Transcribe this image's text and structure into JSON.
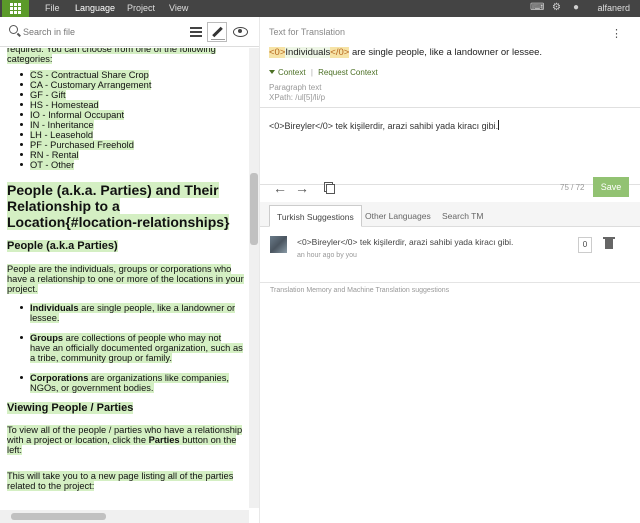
{
  "topbar": {
    "menus": [
      "File",
      "Language",
      "Project",
      "View"
    ],
    "active_menu": "Language",
    "user": "alfanerd"
  },
  "search": {
    "placeholder": "Search in file"
  },
  "document": {
    "intro_fragment": "required. You can choose from one of the following categories:",
    "categories": [
      "CS - Contractual Share Crop",
      "CA - Customary Arrangement",
      "GF - Gift",
      "HS - Homestead",
      "IO - Informal Occupant",
      "IN - Inheritance",
      "LH - Leasehold",
      "PF - Purchased Freehold",
      "RN - Rental",
      "OT - Other"
    ],
    "h1": "People (a.k.a. Parties) and Their Relationship to a Location{#location-relationships}",
    "h2_people": "People (a.k.a Parties)",
    "people_para": "People are the individuals, groups or corporations who have a relationship to one or more of the locations in your project.",
    "party_types": [
      {
        "term": "Individuals",
        "desc": " are single people, like a landowner or lessee."
      },
      {
        "term": "Groups",
        "desc": " are collections of people who may not have an officially documented organization, such as a tribe, community group or family."
      },
      {
        "term": "Corporations",
        "desc": " are organizations like companies, NGOs, or government bodies."
      }
    ],
    "h2_viewing": "Viewing People / Parties",
    "view_para_a": "To view all of the people / parties who have a relationship with a project or location, click the ",
    "view_para_b": "Parties",
    "view_para_c": " button on the left:",
    "new_page_para": "This will take you to a new page listing all of the parties related to the project:"
  },
  "editor": {
    "source_label": "Text for Translation",
    "source_tag_open": "<0>",
    "source_word": "Individuals",
    "source_tag_close": "</0>",
    "source_rest": " are single people, like a landowner or lessee.",
    "context_label": "Context",
    "context_sep": "|",
    "request_context": "Request Context",
    "paragraph_meta": "Paragraph text",
    "xpath_meta": "XPath: /ul[5]/li/p",
    "target_text": "<0>Bireyler</0> tek kişilerdir, arazi sahibi yada kiracı gibi.",
    "char_count": "75 / 72",
    "save_label": "Save",
    "nav_prev_glyph": "←",
    "nav_next_glyph": "→"
  },
  "suggestions": {
    "tabs": [
      "Turkish Suggestions",
      "Other Languages",
      "Search TM"
    ],
    "active_tab": "Turkish Suggestions",
    "items": [
      {
        "text": "<0>Bireyler</0> tek kişilerdir, arazi sahibi yada kiracı gibi.",
        "meta": "an hour ago by you",
        "votes": "0"
      }
    ],
    "tm_label": "Translation Memory and Machine Translation suggestions"
  },
  "colors": {
    "accent_green": "#5b9a2a",
    "highlight_green": "#d4efc3",
    "save_button": "#92c272",
    "tag_bg": "#f6e3a6"
  }
}
